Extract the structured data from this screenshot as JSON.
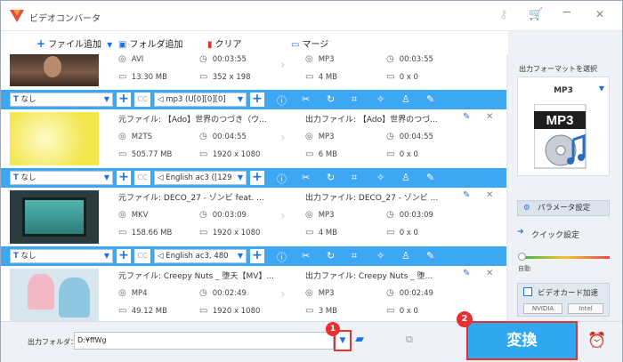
{
  "app": {
    "title": "ビデオコンバータ",
    "min": "─",
    "close": "✕"
  },
  "toolbar": {
    "add_file": "ファイル追加",
    "add_folder": "フォルダ追加",
    "clear": "クリア",
    "merge": "マージ"
  },
  "rows": [
    {
      "src_name": "",
      "dst_name": "",
      "src_fmt": "AVI",
      "src_dur": "00:03:55",
      "src_size": "13.30 MB",
      "src_res": "352 x 198",
      "dst_fmt": "MP3",
      "dst_dur": "00:03:55",
      "dst_size": "4 MB",
      "dst_res": "0 x 0"
    },
    {
      "src_name": "元ファイル: 【Ado】世界のつづき（ウ...",
      "dst_name": "出力ファイル: 【Ado】世界のつづ...",
      "src_fmt": "M2TS",
      "src_dur": "00:04:55",
      "src_size": "505.77 MB",
      "src_res": "1920 x 1080",
      "dst_fmt": "MP3",
      "dst_dur": "00:04:55",
      "dst_size": "6 MB",
      "dst_res": "0 x 0"
    },
    {
      "src_name": "元ファイル: DECO_27 - ゾンビ feat. ...",
      "dst_name": "出力ファイル: DECO_27 - ゾンビ ...",
      "src_fmt": "MKV",
      "src_dur": "00:03:09",
      "src_size": "158.66 MB",
      "src_res": "1920 x 1080",
      "dst_fmt": "MP3",
      "dst_dur": "00:03:09",
      "dst_size": "4 MB",
      "dst_res": "0 x 0"
    },
    {
      "src_name": "元ファイル: Creepy Nuts _ 堕天【MV】...",
      "dst_name": "出力ファイル: Creepy Nuts _ 堕...",
      "src_fmt": "MP4",
      "src_dur": "00:02:49",
      "src_size": "49.12 MB",
      "src_res": "1920 x 1080",
      "dst_fmt": "MP3",
      "dst_dur": "00:02:49",
      "dst_size": "3 MB",
      "dst_res": "0 x 0"
    }
  ],
  "bars": [
    {
      "subtitle": "なし",
      "audio": "mp3 (U[0][0][0]",
      "cc": "CC"
    },
    {
      "subtitle": "なし",
      "audio": "English ac3 ([129",
      "cc": "CC"
    },
    {
      "subtitle": "なし",
      "audio": "English ac3, 480",
      "cc": "CC"
    }
  ],
  "sidebar": {
    "title": "出力フォーマットを選択",
    "format": "MP3",
    "icon_text": "MP3",
    "param": "パラメータ設定",
    "quick": "クイック設定",
    "auto": "自動",
    "hw": "ビデオカード加速",
    "nvidia": "NVIDIA",
    "intel": "Intel"
  },
  "bottom": {
    "out_label": "出力フォルダ：",
    "out_path": "D:¥ffWg",
    "convert": "変換",
    "badge1": "1",
    "badge2": "2"
  }
}
